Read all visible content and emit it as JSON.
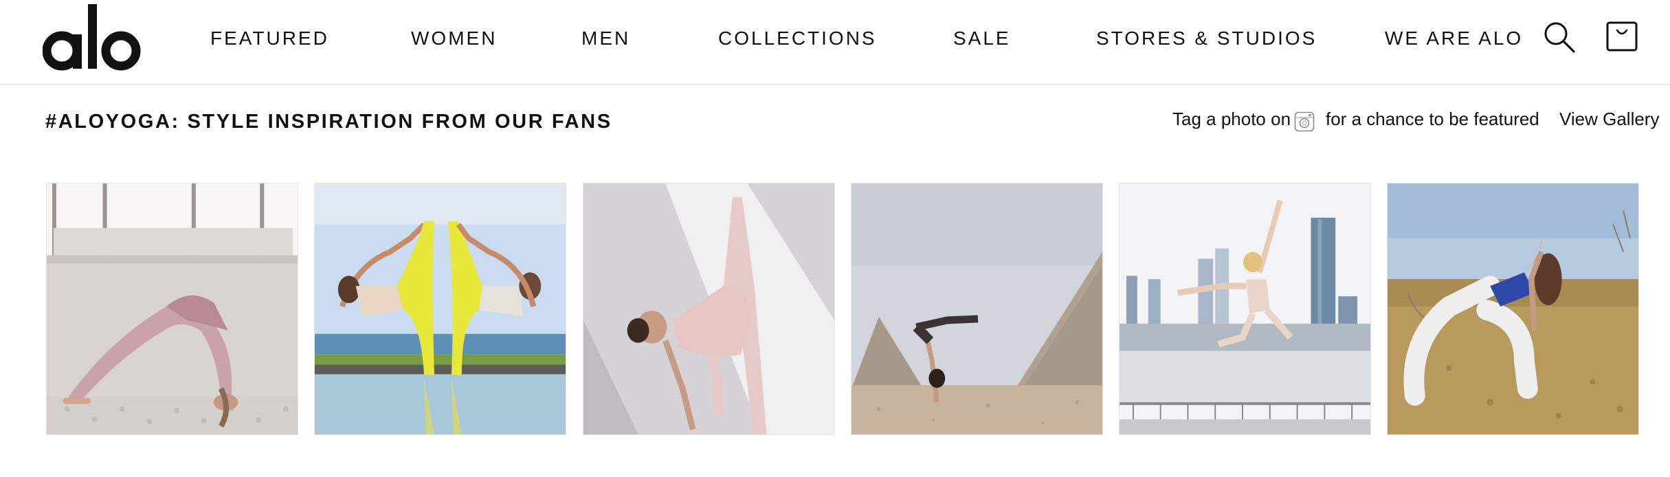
{
  "brand": {
    "logo_text": "alo"
  },
  "nav": {
    "items": [
      "FEATURED",
      "WOMEN",
      "MEN",
      "COLLECTIONS",
      "SALE",
      "STORES & STUDIOS",
      "WE ARE ALO"
    ],
    "search_icon": "search-icon",
    "cart_icon": "shopping-bag-icon"
  },
  "gallery": {
    "title": "#ALOYOGA: STYLE INSPIRATION FROM OUR FANS",
    "tag_prefix": "Tag a photo on",
    "tag_icon": "instagram-icon",
    "tag_suffix": "for a chance to be featured",
    "view_gallery": "View Gallery",
    "photos": [
      {
        "subject": "woman in wheel pose by window"
      },
      {
        "subject": "two women in yellow leggings in standing splits by pool"
      },
      {
        "subject": "woman in standing split against white wall"
      },
      {
        "subject": "woman in forearm stand near pyramids"
      },
      {
        "subject": "woman leaping in front of city skyline"
      },
      {
        "subject": "woman in low lunge backbend in field"
      }
    ]
  },
  "colors": {
    "text": "#111111",
    "border": "#e6e6e6",
    "background": "#ffffff"
  }
}
